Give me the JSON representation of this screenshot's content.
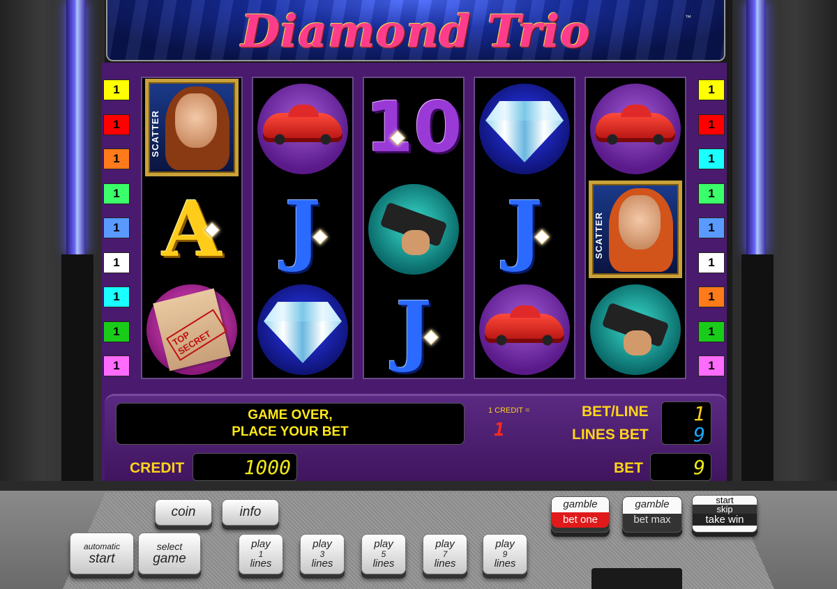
{
  "title": "Diamond Trio",
  "trademark": "™",
  "line_markers": {
    "left": [
      {
        "label": "1",
        "color": "#ffff00"
      },
      {
        "label": "1",
        "color": "#ff0000"
      },
      {
        "label": "1",
        "color": "#ff7a1a"
      },
      {
        "label": "1",
        "color": "#3aff6a"
      },
      {
        "label": "1",
        "color": "#5a9aff"
      },
      {
        "label": "1",
        "color": "#ffffff"
      },
      {
        "label": "1",
        "color": "#1affff"
      },
      {
        "label": "1",
        "color": "#1acc1a"
      },
      {
        "label": "1",
        "color": "#ff6aff"
      }
    ],
    "right": [
      {
        "label": "1",
        "color": "#ffff00"
      },
      {
        "label": "1",
        "color": "#ff0000"
      },
      {
        "label": "1",
        "color": "#1affff"
      },
      {
        "label": "1",
        "color": "#3aff6a"
      },
      {
        "label": "1",
        "color": "#5a9aff"
      },
      {
        "label": "1",
        "color": "#ffffff"
      },
      {
        "label": "1",
        "color": "#ff7a1a"
      },
      {
        "label": "1",
        "color": "#1acc1a"
      },
      {
        "label": "1",
        "color": "#ff6aff"
      }
    ]
  },
  "reels": [
    [
      "scatter-woman-brunette",
      "letter-A",
      "top-secret-envelope"
    ],
    [
      "red-sports-car",
      "letter-J",
      "diamond"
    ],
    [
      "number-10",
      "gun-hand",
      "letter-J"
    ],
    [
      "diamond",
      "letter-J",
      "red-sports-car"
    ],
    [
      "red-sports-car",
      "scatter-woman-redhead",
      "gun-hand"
    ]
  ],
  "symbol_text": {
    "scatter": "SCATTER",
    "top_secret": "TOP SECRET",
    "A": "A",
    "J": "J",
    "ten": "10"
  },
  "message": {
    "line1": "GAME OVER,",
    "line2": "PLACE YOUR BET"
  },
  "credit_info": {
    "label": "1 CREDIT =",
    "value": "1"
  },
  "meters": {
    "credit_label": "CREDIT",
    "credit_value": "1000",
    "bet_line_label": "BET/LINE",
    "bet_line_value": "1",
    "lines_bet_label": "LINES BET",
    "lines_bet_value": "9",
    "bet_label": "BET",
    "bet_value": "9"
  },
  "buttons": {
    "coin": "coin",
    "info": "info",
    "auto_top": "automatic",
    "auto_bottom": "start",
    "select_top": "select",
    "select_bottom": "game",
    "play": [
      {
        "top": "play",
        "num": "1",
        "bottom": "lines"
      },
      {
        "top": "play",
        "num": "3",
        "bottom": "lines"
      },
      {
        "top": "play",
        "num": "5",
        "bottom": "lines"
      },
      {
        "top": "play",
        "num": "7",
        "bottom": "lines"
      },
      {
        "top": "play",
        "num": "9",
        "bottom": "lines"
      }
    ],
    "gamble_one_top": "gamble",
    "gamble_one_bottom": "bet one",
    "gamble_max_top": "gamble",
    "gamble_max_bottom": "bet max",
    "start_top": "start",
    "start_mid": "skip",
    "start_bottom": "take win"
  },
  "colors": {
    "panel": "#4a1a6e",
    "lcd_text": "#f0e81a",
    "label_text": "#ffd41a",
    "bet_line_digit": "#ffd41a",
    "lines_bet_digit": "#1aa8ff"
  }
}
